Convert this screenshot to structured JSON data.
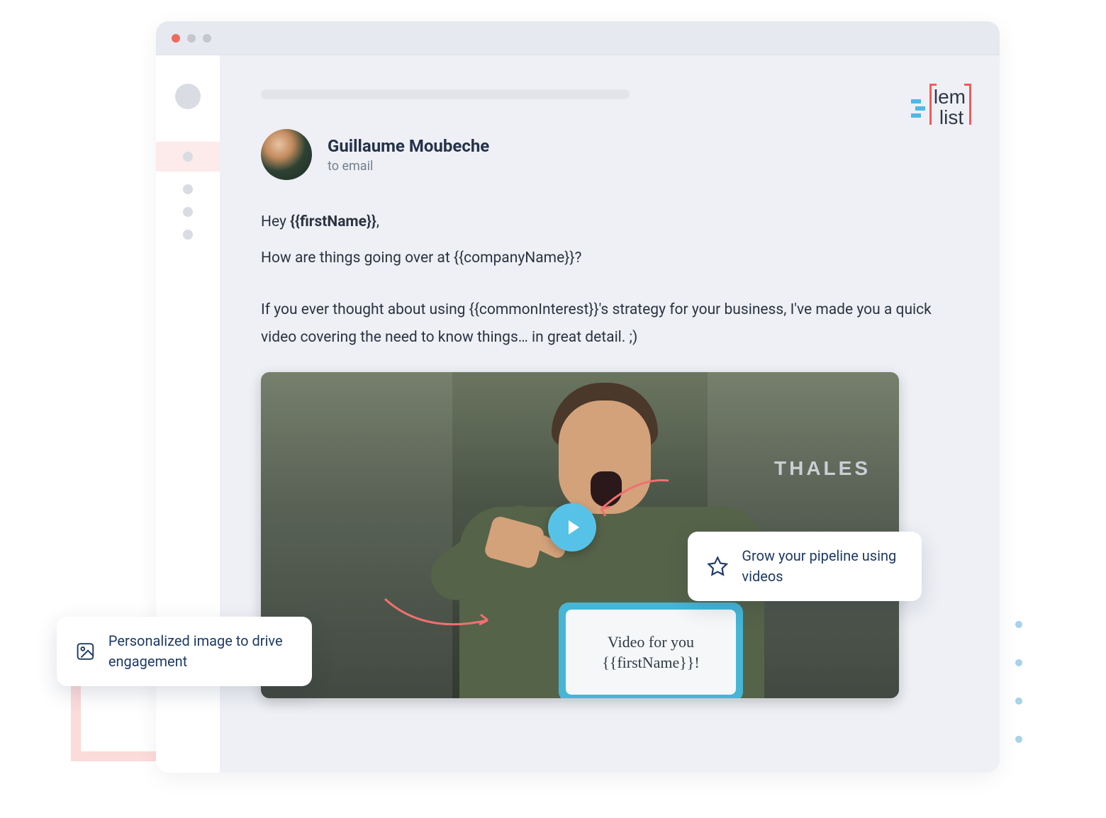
{
  "brand": {
    "line1": "lem",
    "line2": "list"
  },
  "sender": {
    "name": "Guillaume Moubeche",
    "to": "to email"
  },
  "email": {
    "greeting_prefix": "Hey ",
    "greeting_var": "{{firstName}}",
    "greeting_suffix": ",",
    "line1_prefix": "How are things going over at ",
    "line1_var": "{{companyName}}",
    "line1_suffix": "?",
    "line2_prefix": "If you ever thought about using ",
    "line2_var": "{{commonInterest}}",
    "line2_suffix": "'s strategy for your business, I've made you a quick video covering the need to know things… in great detail. ;)"
  },
  "video_card": {
    "banner_text": "THALES",
    "board_line1": "Video for you",
    "board_line2": "{{firstName}}!"
  },
  "callouts": {
    "left": "Personalized image to drive engagement",
    "right": "Grow your pipeline using videos"
  }
}
